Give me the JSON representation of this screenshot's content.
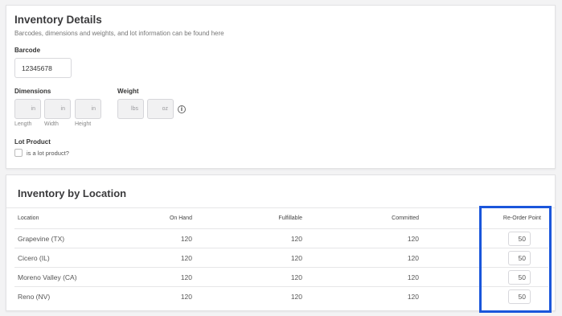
{
  "inventory_details": {
    "title": "Inventory Details",
    "subtitle": "Barcodes, dimensions and weights, and lot information can be found here",
    "barcode_label": "Barcode",
    "barcode_value": "12345678",
    "dimensions_label": "Dimensions",
    "dimension_fields": [
      {
        "unit": "in",
        "caption": "Length"
      },
      {
        "unit": "in",
        "caption": "Width"
      },
      {
        "unit": "in",
        "caption": "Height"
      }
    ],
    "weight_label": "Weight",
    "weight_fields": [
      {
        "unit": "lbs"
      },
      {
        "unit": "oz"
      }
    ],
    "info_icon": "info-icon",
    "lot_label": "Lot Product",
    "lot_checkbox_label": "is a lot product?"
  },
  "inventory_by_location": {
    "title": "Inventory by Location",
    "columns": [
      "Location",
      "On Hand",
      "Fulfillable",
      "Committed",
      "Re-Order Point"
    ],
    "rows": [
      {
        "location": "Grapevine (TX)",
        "on_hand": "120",
        "fulfillable": "120",
        "committed": "120",
        "reorder": "50"
      },
      {
        "location": "Cicero (IL)",
        "on_hand": "120",
        "fulfillable": "120",
        "committed": "120",
        "reorder": "50"
      },
      {
        "location": "Moreno Valley (CA)",
        "on_hand": "120",
        "fulfillable": "120",
        "committed": "120",
        "reorder": "50"
      },
      {
        "location": "Reno (NV)",
        "on_hand": "120",
        "fulfillable": "120",
        "committed": "120",
        "reorder": "50"
      }
    ]
  },
  "colors": {
    "highlight": "#1a56db",
    "background": "#f3f3f4"
  }
}
